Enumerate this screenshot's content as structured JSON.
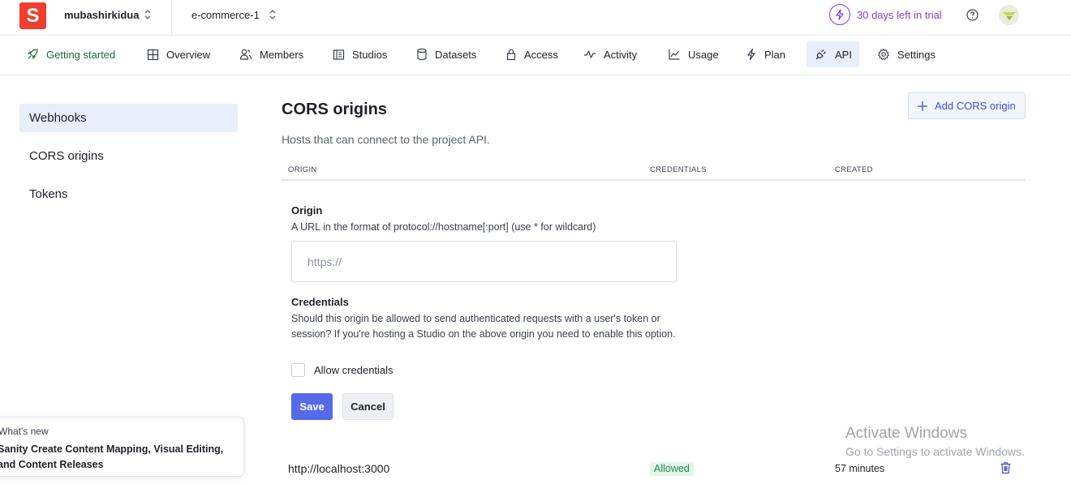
{
  "topbar": {
    "logo_letter": "S",
    "org_name": "mubashirkidua",
    "project_name": "e-commerce-1",
    "trial_text": "30 days left in trial"
  },
  "nav": {
    "tabs": [
      {
        "label": "Getting started",
        "icon": "rocket-icon"
      },
      {
        "label": "Overview",
        "icon": "grid-icon"
      },
      {
        "label": "Members",
        "icon": "users-icon"
      },
      {
        "label": "Studios",
        "icon": "studio-icon"
      },
      {
        "label": "Datasets",
        "icon": "database-icon"
      },
      {
        "label": "Access",
        "icon": "lock-icon"
      },
      {
        "label": "Activity",
        "icon": "activity-icon"
      },
      {
        "label": "Usage",
        "icon": "chart-icon"
      },
      {
        "label": "Plan",
        "icon": "bolt-icon"
      },
      {
        "label": "API",
        "icon": "plug-icon"
      },
      {
        "label": "Settings",
        "icon": "gear-icon"
      }
    ],
    "active_tab": "API"
  },
  "sidebar": {
    "items": [
      {
        "label": "Webhooks"
      },
      {
        "label": "CORS origins"
      },
      {
        "label": "Tokens"
      }
    ],
    "active_item": "Webhooks"
  },
  "main": {
    "title": "CORS origins",
    "subtitle": "Hosts that can connect to the project API.",
    "add_button": "Add CORS origin",
    "columns": [
      "ORIGIN",
      "CREDENTIALS",
      "CREATED"
    ],
    "form": {
      "origin_label": "Origin",
      "origin_help": "A URL in the format of protocol://hostname[:port] (use * for wildcard)",
      "origin_value": "",
      "origin_placeholder": "https://",
      "credentials_label": "Credentials",
      "credentials_help": "Should this origin be allowed to send authenticated requests with a user's token or session? If you're hosting a Studio on the above origin you need to enable this option.",
      "allow_credentials_label": "Allow credentials",
      "allow_credentials_checked": false,
      "save_label": "Save",
      "cancel_label": "Cancel"
    },
    "rows": [
      {
        "origin": "http://localhost:3000",
        "credentials": "Allowed",
        "created": "57 minutes"
      }
    ]
  },
  "whats_new": {
    "heading": "What's new",
    "body": "Sanity Create Content Mapping, Visual Editing, and Content Releases"
  },
  "windows_watermark": {
    "line1": "Activate Windows",
    "line2": "Go to Settings to activate Windows."
  },
  "colors": {
    "brand": "#f03e2f",
    "accent": "#556ae8",
    "trial": "#8b3bd1",
    "active_bg": "#e8eefc",
    "allowed_bg": "#e3f6ea",
    "allowed_text": "#1d8a4a"
  }
}
